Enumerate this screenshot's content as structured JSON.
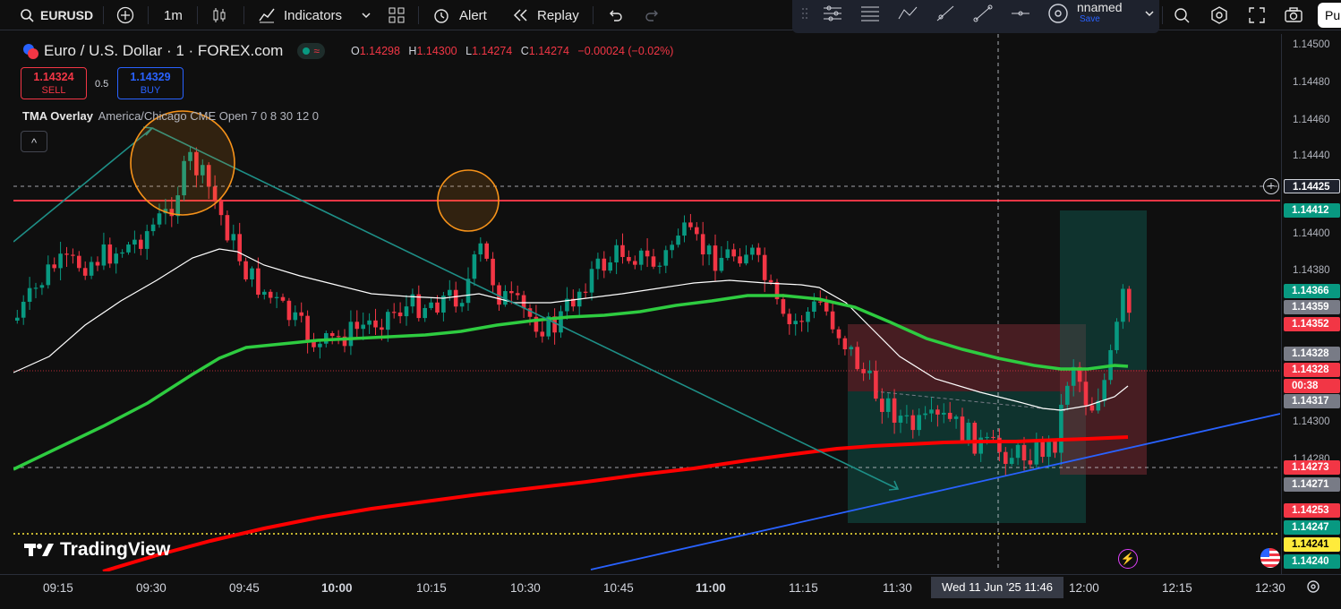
{
  "toolbar": {
    "symbol": "EURUSD",
    "interval": "1m",
    "indicators_label": "Indicators",
    "alert_label": "Alert",
    "replay_label": "Replay",
    "layout_name": "nnamed",
    "save_label": "Save",
    "publish_label": "Pu"
  },
  "legend": {
    "title": "Euro / U.S. Dollar · 1 · FOREX.com",
    "open_label": "O",
    "open": "1.14298",
    "high_label": "H",
    "high": "1.14300",
    "low_label": "L",
    "low": "1.14274",
    "close_label": "C",
    "close": "1.14274",
    "change": "−0.00024 (−0.02%)",
    "sell_price": "1.14324",
    "sell_label": "SELL",
    "spread": "0.5",
    "buy_price": "1.14329",
    "buy_label": "BUY",
    "indicator_name": "TMA Overlay",
    "indicator_params": "America/Chicago CME Open 7 0 8 30 12 0",
    "collapse_glyph": "^"
  },
  "watermark": "TradingView",
  "price_axis": {
    "ticks": [
      "1.14500",
      "1.14480",
      "1.14460",
      "1.14440",
      "1.14400",
      "1.14380",
      "1.14300",
      "1.14280"
    ],
    "labels": [
      {
        "text": "1.14425",
        "color": "#1e222d",
        "border": "#d1d4dc"
      },
      {
        "text": "1.14412",
        "color": "#089981"
      },
      {
        "text": "1.14366",
        "color": "#089981"
      },
      {
        "text": "1.14359",
        "color": "#787b86"
      },
      {
        "text": "1.14352",
        "color": "#f23645"
      },
      {
        "text": "1.14328",
        "color": "#787b86"
      },
      {
        "text": "1.14328",
        "color": "#f23645"
      },
      {
        "text": "00:38",
        "color": "#f23645"
      },
      {
        "text": "1.14317",
        "color": "#787b86"
      },
      {
        "text": "1.14273",
        "color": "#f23645"
      },
      {
        "text": "1.14271",
        "color": "#787b86"
      },
      {
        "text": "1.14253",
        "color": "#f23645"
      },
      {
        "text": "1.14247",
        "color": "#089981"
      },
      {
        "text": "1.14241",
        "color": "#ffeb3b",
        "text_color": "#000000"
      },
      {
        "text": "1.14240",
        "color": "#089981"
      }
    ]
  },
  "time_axis": {
    "labels": [
      "09:15",
      "09:30",
      "09:45",
      "10:00",
      "10:15",
      "10:30",
      "10:45",
      "11:00",
      "11:15",
      "11:30",
      "12:00",
      "12:15",
      "12:30"
    ],
    "crosshair_label": "Wed 11 Jun '25   11:46"
  },
  "chart_data": {
    "type": "candlestick",
    "symbol": "EURUSD",
    "timeframe": "1m",
    "x_range": [
      "09:10",
      "12:30"
    ],
    "ylim": [
      1.14228,
      1.14504
    ],
    "resistance_level": 1.14418,
    "dashed_levels": [
      1.14425,
      1.14273
    ],
    "current_price": 1.14328,
    "low_dotted_level": 1.14241,
    "grid": false,
    "candles_sample": [
      {
        "t": "09:35",
        "o": 1.1443,
        "h": 1.14454,
        "l": 1.1441,
        "c": 1.14446
      },
      {
        "t": "10:22",
        "o": 1.14395,
        "h": 1.14424,
        "l": 1.1437,
        "c": 1.1441
      },
      {
        "t": "11:00",
        "o": 1.14395,
        "h": 1.14402,
        "l": 1.14378,
        "c": 1.14384
      },
      {
        "t": "12:06",
        "o": 1.1436,
        "h": 1.14388,
        "l": 1.1431,
        "c": 1.14328
      }
    ],
    "series": [
      {
        "color": "#ffffff",
        "description": "thin white moving average"
      },
      {
        "color": "#2ecc40",
        "description": "green moving average"
      },
      {
        "color": "#ff0000",
        "description": "thick red moving average"
      }
    ]
  }
}
